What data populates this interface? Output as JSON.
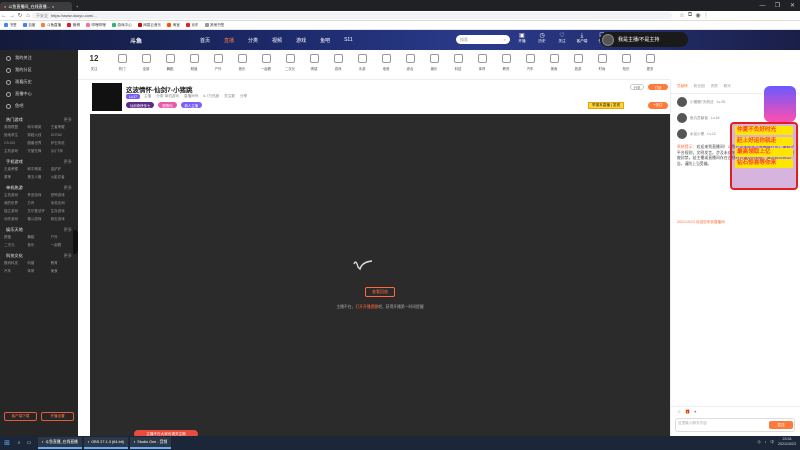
{
  "browser": {
    "active_tab": "斗鱼直播间_在线直播...",
    "window_controls": [
      "—",
      "❐",
      "✕"
    ],
    "url": "https://www.douyu.com/...",
    "security_label": "不安全",
    "bookmarks": [
      "书签",
      "百度",
      "斗鱼直播",
      "微博",
      "哔哩哔哩",
      "游戏中心",
      "网易云音乐",
      "淘宝",
      "京东",
      "其他书签"
    ]
  },
  "site": {
    "logo_text": "斗鱼",
    "nav": [
      {
        "label": "首页",
        "current": false
      },
      {
        "label": "直播",
        "current": true
      },
      {
        "label": "分类",
        "current": false
      },
      {
        "label": "视频",
        "current": false
      },
      {
        "label": "游戏",
        "current": false
      },
      {
        "label": "鱼吧",
        "current": false
      },
      {
        "label": "S11",
        "current": false
      }
    ],
    "search_placeholder": "搜索",
    "header_icons": [
      {
        "label": "开播",
        "icon": "camera-icon"
      },
      {
        "label": "历史",
        "icon": "history-icon"
      },
      {
        "label": "关注",
        "icon": "heart-icon"
      },
      {
        "label": "客户端",
        "icon": "download-icon"
      },
      {
        "label": "任务",
        "icon": "task-icon"
      },
      {
        "label": "消息",
        "icon": "bell-icon"
      }
    ],
    "user_name": "我是主播/不是主持"
  },
  "sidebar": {
    "top_items": [
      "我的关注",
      "我的分区",
      "观看历史",
      "直播中心",
      "鱼吧"
    ],
    "sections": [
      {
        "title": "热门游戏",
        "more": "更多",
        "items": [
          "英雄联盟",
          "和平精英",
          "王者荣耀",
          "绝地求生",
          "穿越火线",
          "DOTA2",
          "CS:GO",
          "魔兽世界",
          "炉石传说",
          "主机游戏",
          "守望先锋",
          "QQ飞车"
        ]
      },
      {
        "title": "手机游戏",
        "more": "更多",
        "items": [
          "王者荣耀",
          "和平精英",
          "金铲铲",
          "原神",
          "第五人格",
          "火影忍者"
        ]
      },
      {
        "title": "单机热游",
        "more": "更多",
        "items": [
          "主机游戏",
          "怀旧游戏",
          "恐怖游戏",
          "我的世界",
          "方舟",
          "永劫无间",
          "独立游戏",
          "艾尔登法环",
          "生存游戏",
          "动作游戏",
          "格斗游戏",
          "射击游戏"
        ]
      },
      {
        "title": "娱乐天地",
        "more": "更多",
        "items": [
          "颜值",
          "舞蹈",
          "户外",
          "二次元",
          "音乐",
          "一起看"
        ]
      },
      {
        "title": "科技文化",
        "more": "更多",
        "items": [
          "数码科技",
          "科普",
          "教育",
          "汽车",
          "体育",
          "美食"
        ]
      }
    ],
    "bottom_buttons": [
      "客户端下载",
      "开播设置"
    ]
  },
  "categories": {
    "count_label": "关注",
    "count": "12",
    "items": [
      "热门",
      "全部",
      "舞蹈",
      "颜值",
      "户外",
      "音乐",
      "一起看",
      "二次元",
      "情感",
      "游戏",
      "手游",
      "电竞",
      "综合",
      "娱乐",
      "科技",
      "体育",
      "教育",
      "汽车",
      "美食",
      "旅游",
      "时尚",
      "知识",
      "更多"
    ]
  },
  "room": {
    "title": "这波情怀-仙剑7-小猪跳",
    "meta": [
      "主播",
      "分类·单机游戏",
      "直播间号",
      "6.7万热度",
      "关注数",
      "分享"
    ],
    "level_tag": "Lv.37",
    "tags": [
      "仙剑奇侠传七",
      "剧情向",
      "新人主播"
    ],
    "report_label": "举报本直播 | 发现",
    "share_label": "分享",
    "subscribe_label": "订阅",
    "follow_label": "+关注"
  },
  "player": {
    "offline_button": "查看回放",
    "offline_text_prefix": "主播不在，",
    "offline_text_highlight": "打开开播提醒",
    "offline_text_suffix": "吧，获得开播第一时间提醒"
  },
  "rightpanel": {
    "tabs": [
      "贡献榜",
      "粉丝团",
      "贵宾",
      "聊天"
    ],
    "ranks": [
      {
        "name": "小猪猪7天粉丝",
        "level": "Lv.26"
      },
      {
        "name": "鱼丸贡献者",
        "level": "Lv.18"
      },
      {
        "name": "水友小黑",
        "level": "Lv.12"
      }
    ],
    "chat_system_label": "系统提示：",
    "chat_text": "欢迎来到直播间！斗鱼严禁未成年人直播或打赏，请遵守平台规则，文明发言。涉及未成年人、低俗色情、吸烟酗酒等内容将被封禁。若主播或直播间存在违规行为请及时举报。请勿轻信各类广告，谨防上当受骗。",
    "chat_bottom": "2021/10/23 欢迎您来到直播间",
    "input_placeholder": "这里输入聊天内容",
    "send_label": "发送"
  },
  "overlay": {
    "lines": [
      "仲夏不负好时光",
      "赶上好运你就走",
      "最高领取上亿",
      "钻石惊喜等你来"
    ]
  },
  "floating_pill": "主播不在大家也请关注哦",
  "taskbar": {
    "apps": [
      "斗鱼直播_在线直播",
      "OBS 27.1.3 (64-bit)",
      "Studio One - 音频"
    ],
    "time": "23:34",
    "date": "2021/10/23",
    "lang": "中"
  }
}
